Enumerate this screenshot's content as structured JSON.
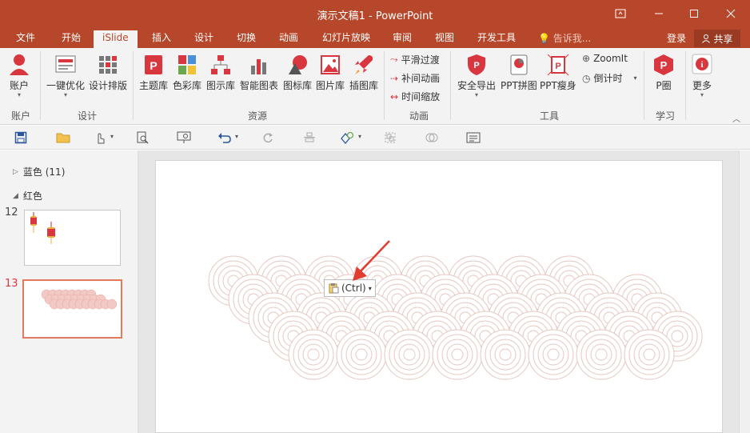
{
  "window": {
    "title": "演示文稿1 - PowerPoint",
    "controls": [
      "ribbon-display-icon",
      "minimize-icon",
      "maximize-icon",
      "close-icon"
    ]
  },
  "tabs": [
    "文件",
    "开始",
    "iSlide",
    "插入",
    "设计",
    "切换",
    "动画",
    "幻灯片放映",
    "审阅",
    "视图",
    "开发工具"
  ],
  "active_tab": "iSlide",
  "tell_me": "告诉我...",
  "login": "登录",
  "share": "共享",
  "ribbon": {
    "account": {
      "button": "账户",
      "group": "账户"
    },
    "design": {
      "one_key": "一键优化",
      "layout": "设计排版",
      "group": "设计"
    },
    "resources": {
      "items": [
        "主题库",
        "色彩库",
        "图示库",
        "智能图表",
        "图标库",
        "图片库",
        "插图库"
      ],
      "group": "资源"
    },
    "animation": {
      "items": [
        "平滑过渡",
        "补间动画",
        "时间缩放"
      ],
      "group": "动画"
    },
    "tools": {
      "safe_export": "安全导出",
      "ppt_collage": "PPT拼图",
      "ppt_slim": "PPT瘦身",
      "zoomit": "ZoomIt",
      "countdown": "倒计时",
      "group": "工具"
    },
    "learn": {
      "p_circle": "P圈",
      "group": "学习"
    },
    "more": "更多"
  },
  "quick_access": [
    "save-icon",
    "open-folder-icon",
    "touch-mode-icon",
    "print-preview-icon",
    "present-icon",
    "undo-icon",
    "redo-icon",
    "align-icon",
    "shapes-icon",
    "group-icon",
    "merge-shapes-icon",
    "picture-icon"
  ],
  "slides_panel": {
    "sections": [
      {
        "label": "蓝色 (11)",
        "collapsed": true
      },
      {
        "label": "红色",
        "collapsed": false
      }
    ],
    "slides": [
      {
        "number": "12",
        "selected": false
      },
      {
        "number": "13",
        "selected": true
      }
    ]
  },
  "paste_options": {
    "label": "(Ctrl)"
  },
  "colors": {
    "accent": "#b7472a",
    "selected_thumb": "#e27a5b",
    "circle_stroke": "#e5c7c1",
    "arrow": "#e03c2f"
  }
}
